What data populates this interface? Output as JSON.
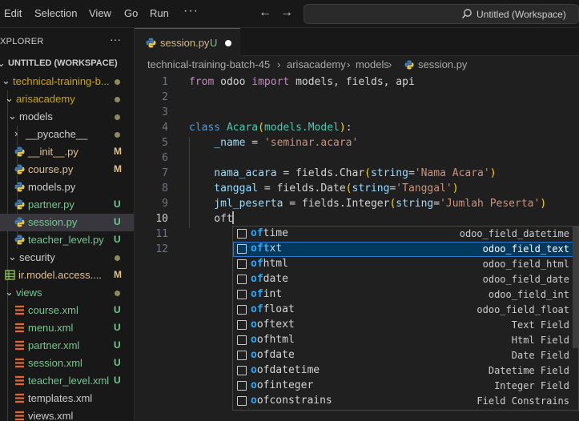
{
  "menu": {
    "edit": "Edit",
    "selection": "Selection",
    "view": "View",
    "go": "Go",
    "run": "Run",
    "more": "···"
  },
  "titlebar": {
    "search_text": "Untitled (Workspace)"
  },
  "explorer": {
    "header": "XPLORER",
    "more": "···",
    "items": [
      {
        "label": "UNTITLED (WORKSPACE)",
        "chev": "⌄",
        "badge": "",
        "color": "#cccccc"
      },
      {
        "label": "technical-training-b...",
        "chev": "⌄",
        "badge": "dot",
        "color": "#cca700"
      },
      {
        "label": "arisacademy",
        "chev": "⌄",
        "badge": "dot",
        "color": "#cca700"
      },
      {
        "label": "models",
        "chev": "⌄",
        "badge": "dot",
        "color": "#cccccc"
      },
      {
        "label": "__pycache__",
        "chev": "›",
        "badge": "dot",
        "color": "#cccccc"
      },
      {
        "label": "__init__.py",
        "chev": "",
        "badge": "M",
        "color": "#e2c08d"
      },
      {
        "label": "course.py",
        "chev": "",
        "badge": "M",
        "color": "#e2c08d"
      },
      {
        "label": "models.py",
        "chev": "",
        "badge": "",
        "color": "#cccccc"
      },
      {
        "label": "partner.py",
        "chev": "",
        "badge": "U",
        "color": "#73c991"
      },
      {
        "label": "session.py",
        "chev": "",
        "badge": "U",
        "color": "#73c991"
      },
      {
        "label": "teacher_level.py",
        "chev": "",
        "badge": "U",
        "color": "#73c991"
      },
      {
        "label": "security",
        "chev": "⌄",
        "badge": "dot",
        "color": "#cccccc"
      },
      {
        "label": "ir.model.access....",
        "chev": "",
        "badge": "M",
        "color": "#e2c08d"
      },
      {
        "label": "views",
        "chev": "⌄",
        "badge": "dot",
        "color": "#73c991"
      },
      {
        "label": "course.xml",
        "chev": "",
        "badge": "U",
        "color": "#73c991"
      },
      {
        "label": "menu.xml",
        "chev": "",
        "badge": "U",
        "color": "#73c991"
      },
      {
        "label": "partner.xml",
        "chev": "",
        "badge": "U",
        "color": "#73c991"
      },
      {
        "label": "session.xml",
        "chev": "",
        "badge": "U",
        "color": "#73c991"
      },
      {
        "label": "teacher_level.xml",
        "chev": "",
        "badge": "U",
        "color": "#73c991"
      },
      {
        "label": "templates.xml",
        "chev": "",
        "badge": "",
        "color": "#cccccc"
      },
      {
        "label": "views.xml",
        "chev": "",
        "badge": "",
        "color": "#cccccc"
      }
    ]
  },
  "tab": {
    "name": "session.py",
    "status": "U"
  },
  "breadcrumb": {
    "p1": "technical-training-batch-45",
    "p2": "arisacademy",
    "p3": "models",
    "p4": "session.py",
    "sep": "›"
  },
  "editor": {
    "line_numbers": [
      "1",
      "2",
      "3",
      "4",
      "5",
      "6",
      "7",
      "8",
      "9",
      "10",
      "11",
      "12"
    ],
    "line1": {
      "kw1": "from",
      "mod": " odoo ",
      "kw2": "import",
      "rest": " models, fields, api"
    },
    "line4": {
      "kw": "class",
      "name": " Acara",
      "p1": "(",
      "base": "models.Model",
      "p2": ")",
      "colon": ":"
    },
    "line5": {
      "var": "    _name",
      "eq": " = ",
      "str": "'seminar.acara'"
    },
    "line7": {
      "var": "    nama_acara",
      "eq": " = fields.Char",
      "p1": "(",
      "arg": "string",
      "eq2": "=",
      "str": "'Nama Acara'",
      "p2": ")"
    },
    "line8": {
      "var": "    tanggal",
      "eq": " = fields.Date",
      "p1": "(",
      "arg": "string",
      "eq2": "=",
      "str": "'Tanggal'",
      "p2": ")"
    },
    "line9": {
      "var": "    jml_peserta",
      "eq": " = fields.Integer",
      "p1": "(",
      "arg": "string",
      "eq2": "=",
      "str": "'Jumlah Peserta'",
      "p2": ")"
    },
    "line10": {
      "var": "    oft"
    }
  },
  "suggestions": [
    {
      "match": "of",
      "rest": "time",
      "detail": "odoo_field_datetime"
    },
    {
      "match": "oft",
      "rest": "xt",
      "detail": "odoo_field_text"
    },
    {
      "match": "of",
      "rest": "html",
      "detail": "odoo_field_html"
    },
    {
      "match": "of",
      "rest": "date",
      "detail": "odoo_field_date"
    },
    {
      "match": "of",
      "rest": "int",
      "detail": "odoo_field_int"
    },
    {
      "match": "of",
      "rest": "float",
      "detail": "odoo_field_float"
    },
    {
      "match": "o",
      "rest": "oftext",
      "detail": "Text Field"
    },
    {
      "match": "o",
      "rest": "ofhtml",
      "detail": "Html Field"
    },
    {
      "match": "o",
      "rest": "ofdate",
      "detail": "Date Field"
    },
    {
      "match": "o",
      "rest": "ofdatetime",
      "detail": "Datetime Field"
    },
    {
      "match": "o",
      "rest": "ofinteger",
      "detail": "Integer Field"
    },
    {
      "match": "o",
      "rest": "ofconstrains",
      "detail": "Field Constrains"
    }
  ]
}
